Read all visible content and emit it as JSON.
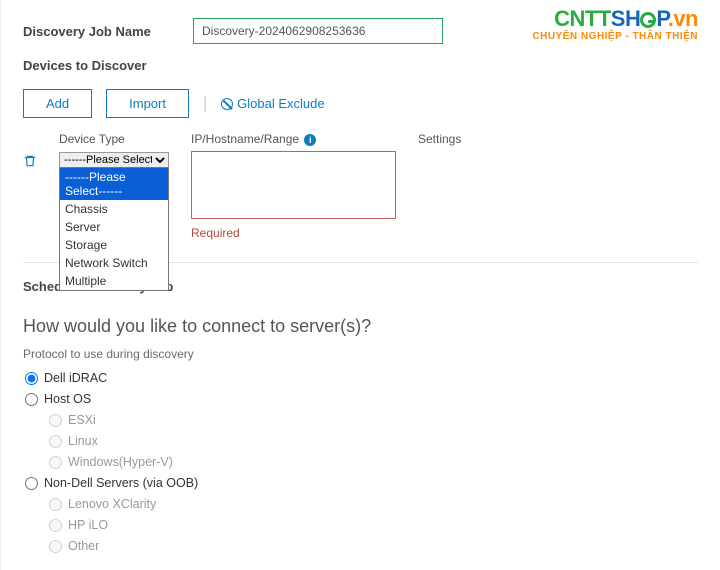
{
  "logo": {
    "part1": "CNTT",
    "part2": "SH",
    "part3": "P",
    "suffix": ".vn",
    "tagline": "CHUYÊN NGHIỆP - THÂN THIỆN"
  },
  "jobname": {
    "label": "Discovery Job Name",
    "value": "Discovery-2024062908253636"
  },
  "devices": {
    "section_title": "Devices to Discover",
    "add_label": "Add",
    "import_label": "Import",
    "global_exclude": "Global Exclude",
    "columns": {
      "device_type": "Device Type",
      "ip": "IP/Hostname/Range",
      "settings": "Settings"
    },
    "device_type_selected": "------Please Select------",
    "device_type_options": [
      "------Please Select------",
      "Chassis",
      "Server",
      "Storage",
      "Network Switch",
      "Multiple"
    ],
    "required": "Required"
  },
  "schedule": {
    "section_title": "Schedule Discovery Job",
    "connect_question": "How would you like to connect to server(s)?",
    "protocol_label": "Protocol to use during discovery",
    "radios": {
      "idrac": "Dell iDRAC",
      "hostos": "Host OS",
      "esxi": "ESXi",
      "linux": "Linux",
      "hyperv": "Windows(Hyper-V)",
      "nondell": "Non-Dell Servers (via OOB)",
      "lenovo": "Lenovo XClarity",
      "hpilo": "HP iLO",
      "other": "Other"
    }
  }
}
